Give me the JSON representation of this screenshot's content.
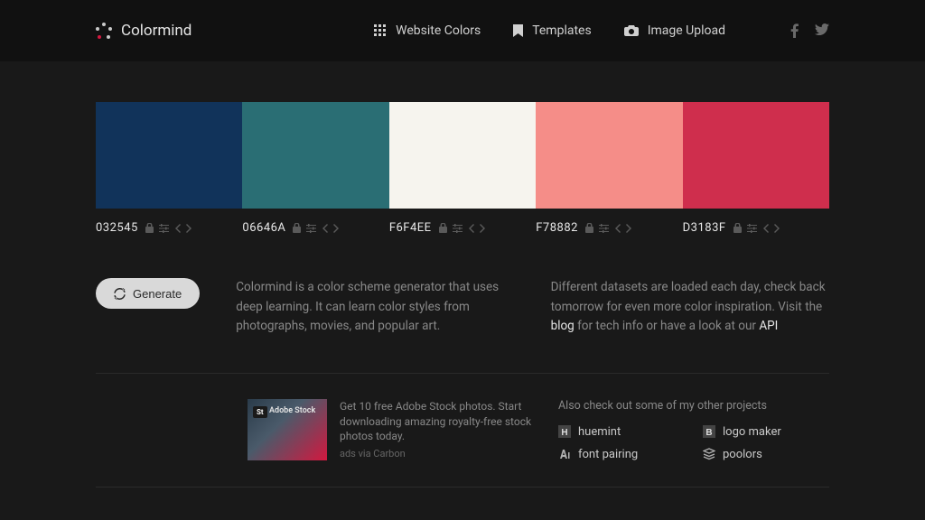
{
  "brand": "Colormind",
  "nav": {
    "website_colors": "Website Colors",
    "templates": "Templates",
    "image_upload": "Image Upload"
  },
  "palette": [
    {
      "hex": "032545",
      "color": "#11335a"
    },
    {
      "hex": "06646A",
      "color": "#2a6e74"
    },
    {
      "hex": "F6F4EE",
      "color": "#f6f4ee"
    },
    {
      "hex": "F78882",
      "color": "#f58d88"
    },
    {
      "hex": "D3183F",
      "color": "#cf2e4d"
    }
  ],
  "generate_label": "Generate",
  "description_left": "Colormind is a color scheme generator that uses deep learning. It can learn color styles from photographs, movies, and popular art.",
  "description_right_pre": "Different datasets are loaded each day, check back tomorrow for even more color inspiration. Visit the ",
  "description_right_blog": "blog",
  "description_right_mid": " for tech info or have a look at our ",
  "description_right_api": "API",
  "ad": {
    "badge": "St",
    "brand": "Adobe Stock",
    "text": "Get 10 free Adobe Stock photos. Start downloading amazing royalty-free stock photos today.",
    "via": "ads via Carbon"
  },
  "projects": {
    "heading": "Also check out some of my other projects",
    "items": [
      "huemint",
      "logo maker",
      "font pairing",
      "poolors"
    ]
  }
}
